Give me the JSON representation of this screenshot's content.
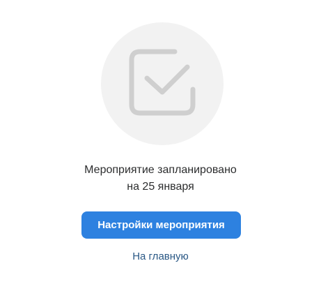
{
  "illustration": {
    "icon": "checkbox-checked-icon",
    "circle_color": "#f2f2f2",
    "icon_color": "#cfcfcf"
  },
  "message": {
    "line1": "Мероприятие запланировано",
    "line2": "на 25 января"
  },
  "actions": {
    "primary_label": "Настройки мероприятия",
    "primary_color": "#2d81e0",
    "link_label": "На главную",
    "link_color": "#2a5885"
  }
}
